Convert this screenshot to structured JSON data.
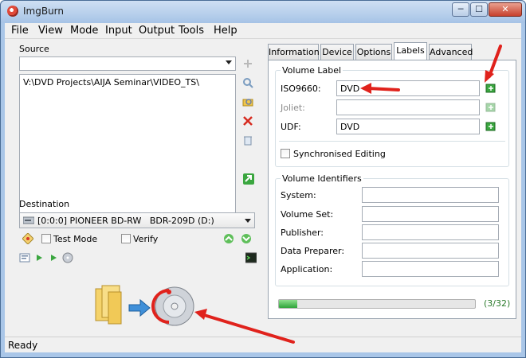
{
  "window": {
    "title": "ImgBurn"
  },
  "window_buttons": {
    "min": "─",
    "max": "☐",
    "close": "✕"
  },
  "menu": [
    "File",
    "View",
    "Mode",
    "Input",
    "Output",
    "Tools",
    "Help"
  ],
  "source": {
    "label": "Source",
    "combo_value": "",
    "path": "V:\\DVD Projects\\AIJA Seminar\\VIDEO_TS\\"
  },
  "destination": {
    "label": "Destination",
    "drive": "[0:0:0] PIONEER BD-RW   BDR-209D (D:)",
    "test_mode": "Test Mode",
    "verify": "Verify"
  },
  "tabs": [
    "Information",
    "Device",
    "Options",
    "Labels",
    "Advanced"
  ],
  "active_tab": "Labels",
  "volume_label": {
    "title": "Volume Label",
    "iso_label": "ISO9660:",
    "iso_value": "DVD",
    "joliet_label": "Joliet:",
    "joliet_value": "",
    "udf_label": "UDF:",
    "udf_value": "DVD",
    "sync_label": "Synchronised Editing"
  },
  "volume_identifiers": {
    "title": "Volume Identifiers",
    "system": "System:",
    "volume_set": "Volume Set:",
    "publisher": "Publisher:",
    "data_preparer": "Data Preparer:",
    "application": "Application:"
  },
  "progress": {
    "fraction": 0.094,
    "text": "(3/32)"
  },
  "status": "Ready",
  "colors": {
    "accent": "#e0221c",
    "progress": "#2fa43a",
    "window_frame": "#a9c6e8"
  }
}
